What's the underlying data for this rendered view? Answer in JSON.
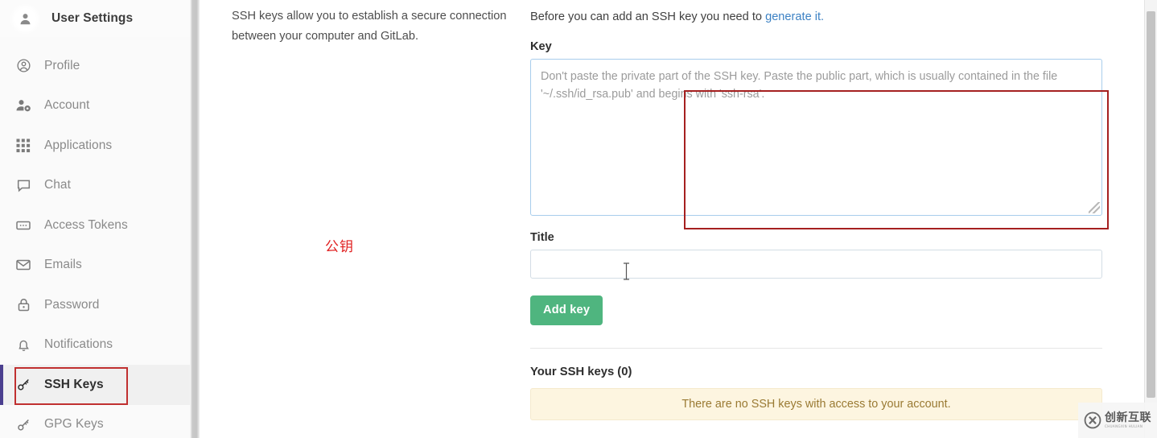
{
  "sidebar": {
    "header": {
      "title": "User Settings",
      "icon": "user-avatar-icon"
    },
    "items": [
      {
        "label": "Profile",
        "icon": "profile-circle-icon",
        "active": false
      },
      {
        "label": "Account",
        "icon": "account-gear-icon",
        "active": false
      },
      {
        "label": "Applications",
        "icon": "grid-dots-icon",
        "active": false
      },
      {
        "label": "Chat",
        "icon": "chat-bubble-icon",
        "active": false
      },
      {
        "label": "Access Tokens",
        "icon": "token-card-icon",
        "active": false
      },
      {
        "label": "Emails",
        "icon": "envelope-icon",
        "active": false
      },
      {
        "label": "Password",
        "icon": "lock-icon",
        "active": false
      },
      {
        "label": "Notifications",
        "icon": "bell-icon",
        "active": false
      },
      {
        "label": "SSH Keys",
        "icon": "key-icon",
        "active": true
      },
      {
        "label": "GPG Keys",
        "icon": "key-icon",
        "active": false
      }
    ]
  },
  "content": {
    "intro": "SSH keys allow you to establish a secure connection between your computer and GitLab.",
    "lead_prefix": "Before you can add an SSH key you need to ",
    "lead_link": "generate it.",
    "key_label": "Key",
    "key_placeholder": "Don't paste the private part of the SSH key. Paste the public part, which is usually contained in the file '~/.ssh/id_rsa.pub' and begins with 'ssh-rsa'.",
    "key_value": "",
    "title_label": "Title",
    "title_value": "",
    "title_placeholder": "",
    "add_key_label": "Add key",
    "list_heading": "Your SSH keys (0)",
    "empty_alert": "There are no SSH keys with access to your account."
  },
  "annotations": {
    "chinese_label": "公钥",
    "box_color": "#a52020",
    "label_color": "#e02020"
  },
  "watermark": {
    "main": "创新互联",
    "sub": "CHUANGXIN HULIAN"
  },
  "colors": {
    "accent_green": "#4fb57f",
    "link_blue": "#3d82c4",
    "active_bar": "#4b3f8f",
    "alert_bg": "#fdf5e0",
    "alert_text": "#9a7a33"
  }
}
